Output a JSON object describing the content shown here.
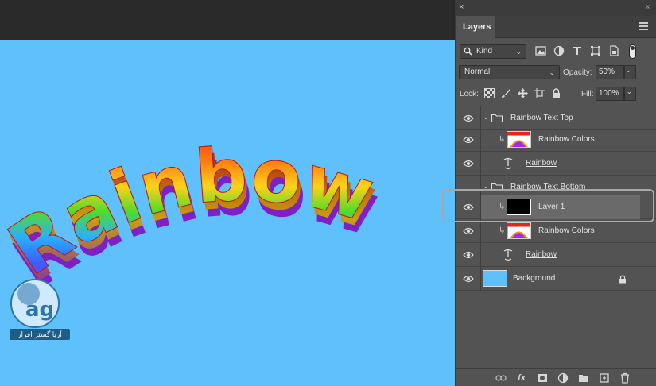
{
  "canvas": {
    "background_color": "#5fc0fb",
    "artwork_text": "Rainbow",
    "watermark_text": "آریا گستر افزار"
  },
  "panel": {
    "close_glyph": "×",
    "collapse_glyph": "«",
    "tab_label": "Layers",
    "filter": {
      "kind_label": "Kind",
      "icons": [
        "image-filter-icon",
        "adjustment-filter-icon",
        "type-filter-icon",
        "shape-filter-icon",
        "smart-object-filter-icon"
      ]
    },
    "blend_mode": "Normal",
    "opacity_label": "Opacity:",
    "opacity_value": "50%",
    "lock_label": "Lock:",
    "lock_icons": [
      "lock-transparent-icon",
      "lock-paint-icon",
      "lock-position-icon",
      "lock-artboard-icon",
      "lock-all-icon"
    ],
    "fill_label": "Fill:",
    "fill_value": "100%"
  },
  "layers": [
    {
      "name": "Rainbow Text Top",
      "type": "group",
      "visible": true,
      "expanded": true
    },
    {
      "name": "Rainbow Colors",
      "type": "image",
      "visible": true,
      "clipped": true
    },
    {
      "name": "Rainbow",
      "type": "text",
      "visible": true
    },
    {
      "name": "Rainbow Text Bottom",
      "type": "group",
      "visible": true,
      "expanded": true
    },
    {
      "name": "Layer 1",
      "type": "fill",
      "visible": true,
      "clipped": true,
      "selected": true
    },
    {
      "name": "Rainbow Colors",
      "type": "image",
      "visible": true,
      "clipped": true
    },
    {
      "name": "Rainbow",
      "type": "text",
      "visible": true
    },
    {
      "name": "Background",
      "type": "background",
      "visible": true,
      "locked": true
    }
  ],
  "bottom_bar": [
    "link-layers-icon",
    "fx-icon",
    "add-mask-icon",
    "adjustment-layer-icon",
    "new-group-icon",
    "new-layer-icon",
    "delete-layer-icon"
  ],
  "colors": {
    "panel_bg": "#535353",
    "selected_row": "#6a6a6a",
    "canvas_bg": "#5fc0fb"
  }
}
